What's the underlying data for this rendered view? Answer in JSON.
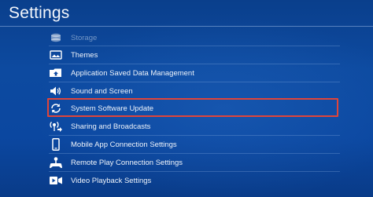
{
  "header": {
    "title": "Settings"
  },
  "menu": {
    "items": [
      {
        "label": "Storage",
        "icon": "storage-icon"
      },
      {
        "label": "Themes",
        "icon": "themes-icon"
      },
      {
        "label": "Application Saved Data Management",
        "icon": "saved-data-icon"
      },
      {
        "label": "Sound and Screen",
        "icon": "speaker-icon"
      },
      {
        "label": "System Software Update",
        "icon": "refresh-icon"
      },
      {
        "label": "Sharing and Broadcasts",
        "icon": "broadcast-icon"
      },
      {
        "label": "Mobile App Connection Settings",
        "icon": "mobile-phone-icon"
      },
      {
        "label": "Remote Play Connection Settings",
        "icon": "remote-play-icon"
      },
      {
        "label": "Video Playback Settings",
        "icon": "video-playback-icon"
      }
    ],
    "selected_index": 4
  },
  "colors": {
    "background": "#0b47a0",
    "highlight_border": "#e0453a",
    "text": "#eef3fa"
  }
}
